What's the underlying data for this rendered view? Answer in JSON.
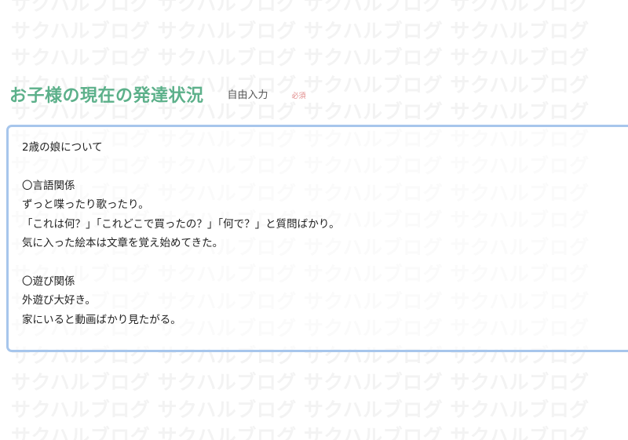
{
  "watermark": {
    "lines": [
      "サクハルブログ サクハルブログ サクハルブログ サクハルブログ",
      "サクハルブログ サクハルブログ サクハルブログ サクハルブログ",
      "サクハルブログ サクハルブログ サクハルブログ サクハルブログ",
      "サクハルブログ サクハルブログ サクハルブログ サクハルブログ",
      "サクハルブログ サクハルブログ サクハルブログ サクハルブログ",
      "サクハルブログ サクハルブログ サクハルブログ サクハルブログ",
      "サクハルブログ サクハルブログ サクハルブログ サクハルブログ",
      "サクハルブログ サクハルブログ サクハルブログ サクハルブログ",
      "サクハルブログ サクハルブログ サクハルブログ サクハルブログ",
      "サクハルブログ サクハルブログ サクハルブログ サクハルブログ",
      "サクハルブログ サクハルブログ サクハルブログ サクハルブログ",
      "サクハルブログ サクハルブログ サクハルブログ サクハルブログ",
      "サクハルブログ サクハルブログ サクハルブログ サクハルブログ",
      "サクハルブログ サクハルブログ サクハルブログ サクハルブログ",
      "サクハルブログ サクハルブログ サクハルブログ サクハルブログ",
      "サクハルブログ サクハルブログ サクハルブログ サクハルブログ",
      "サクハルブログ サクハルブログ サクハルブログ サクハルブログ"
    ]
  },
  "field": {
    "title": "お子様の現在の発達状況",
    "type_label": "自由入力",
    "required_label": "必須",
    "value": "2歳の娘について\n\n〇言語関係\nずっと喋ったり歌ったり。\n「これは何？」「これどこで買ったの？」「何で？」と質問ばかり。\n気に入った絵本は文章を覚え始めてきた。\n\n〇遊び関係\n外遊び大好き。\n家にいると動画ばかり見たがる。"
  },
  "colors": {
    "title": "#5cb08a",
    "required": "#e08888",
    "focus_border": "#a7c6ec",
    "watermark": "#f3f3f3"
  }
}
